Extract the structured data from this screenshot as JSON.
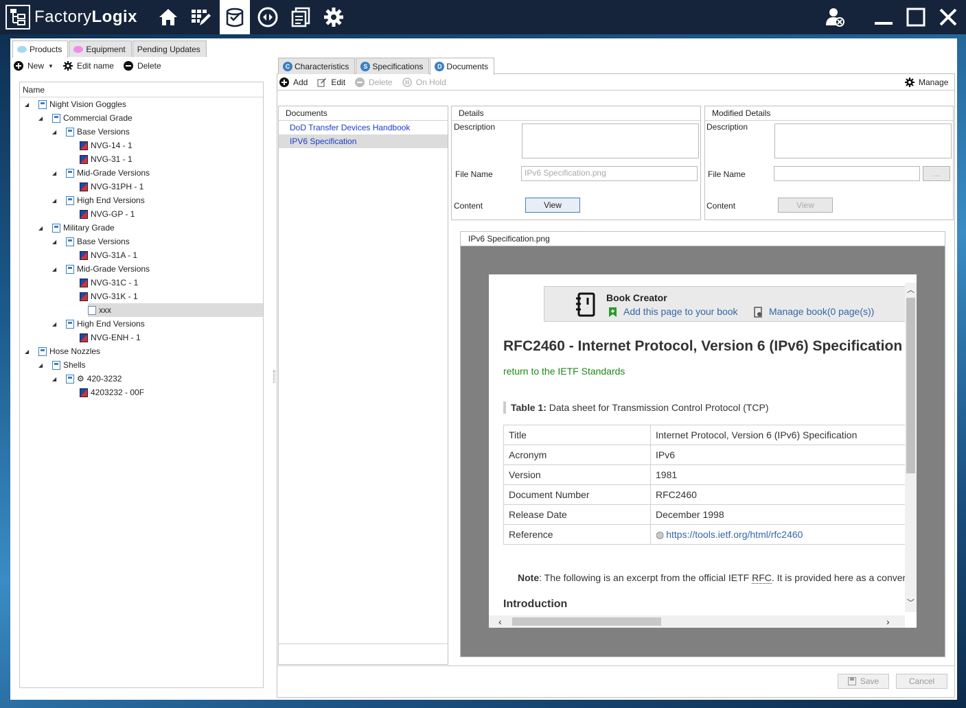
{
  "app": {
    "name_part1": "Factory",
    "name_part2": "Logix"
  },
  "nav": [
    "home-icon",
    "grid-edit-icon",
    "product-data-icon",
    "routing-icon",
    "document-icon",
    "gear-icon"
  ],
  "window": [
    "user-remove-icon",
    "minimize-icon",
    "maximize-icon",
    "close-icon"
  ],
  "left_tabs": [
    {
      "label": "Products",
      "color": "#a8d8f0"
    },
    {
      "label": "Equipment",
      "color": "#f08cf0"
    },
    {
      "label": "Pending Updates"
    }
  ],
  "left_toolbar": {
    "new": "New",
    "edit": "Edit name",
    "delete": "Delete"
  },
  "tree": {
    "header": "Name",
    "nodes": [
      "Night Vision Goggles",
      "Commercial Grade",
      "Base Versions",
      "NVG-14 - 1",
      "NVG-31 - 1",
      "Mid-Grade Versions",
      "NVG-31PH - 1",
      "High End Versions",
      "NVG-GP - 1",
      "Military Grade",
      "Base Versions",
      "NVG-31A - 1",
      "Mid-Grade Versions",
      "NVG-31C - 1",
      "NVG-31K - 1",
      "xxx",
      "High End Versions",
      "NVG-ENH - 1",
      "Hose Nozzles",
      "Shells",
      "420-3232",
      "4203232 - 00F"
    ]
  },
  "right_tabs": [
    {
      "letter": "C",
      "label": "Characteristics"
    },
    {
      "letter": "S",
      "label": "Specifications"
    },
    {
      "letter": "D",
      "label": "Documents"
    }
  ],
  "right_toolbar": {
    "add": "Add",
    "edit": "Edit",
    "delete": "Delete",
    "on_hold": "On Hold",
    "manage": "Manage"
  },
  "documents": {
    "header": "Documents",
    "items": [
      "DoD Transfer Devices Handbook",
      "IPV6 Specification"
    ],
    "selected_index": 1
  },
  "details": {
    "header": "Details",
    "description_label": "Description",
    "file_name_label": "File Name",
    "file_name_value": "IPv6 Specification.png",
    "content_label": "Content",
    "view_label": "View"
  },
  "modified": {
    "header": "Modified Details",
    "description_label": "Description",
    "file_name_label": "File Name",
    "browse_label": "...",
    "content_label": "Content",
    "view_label": "View"
  },
  "preview": {
    "file_name": "IPv6 Specification.png",
    "book_creator": {
      "title": "Book Creator",
      "add_link": "Add this page to your book",
      "manage_link": "Manage book(0 page(s))"
    },
    "heading": "RFC2460 - Internet Protocol, Version 6 (IPv6) Specification",
    "return_link": "return to the IETF Standards",
    "table_caption_bold": "Table 1:",
    "table_caption": " Data sheet for Transmission Control Protocol (TCP)",
    "rows": [
      {
        "k": "Title",
        "v": "Internet Protocol, Version 6 (IPv6) Specification"
      },
      {
        "k": "Acronym",
        "v": "IPv6"
      },
      {
        "k": "Version",
        "v": "1981"
      },
      {
        "k": "Document Number",
        "v": "RFC2460"
      },
      {
        "k": "Release Date",
        "v": "December 1998"
      },
      {
        "k": "Reference",
        "v": "https://tools.ietf.org/html/rfc2460"
      }
    ],
    "note_bold": "Note",
    "note_text": ": The following is an excerpt from the official IETF ",
    "note_abbr": "RFC",
    "note_tail": ". It is provided here as a conver",
    "intro_heading": "Introduction"
  },
  "footer": {
    "save": "Save",
    "cancel": "Cancel"
  },
  "colors": {
    "titlebar": "#15243a",
    "link": "#1a3cc8",
    "accent": "#3a7fc0",
    "green_link": "#1a8a1a"
  }
}
